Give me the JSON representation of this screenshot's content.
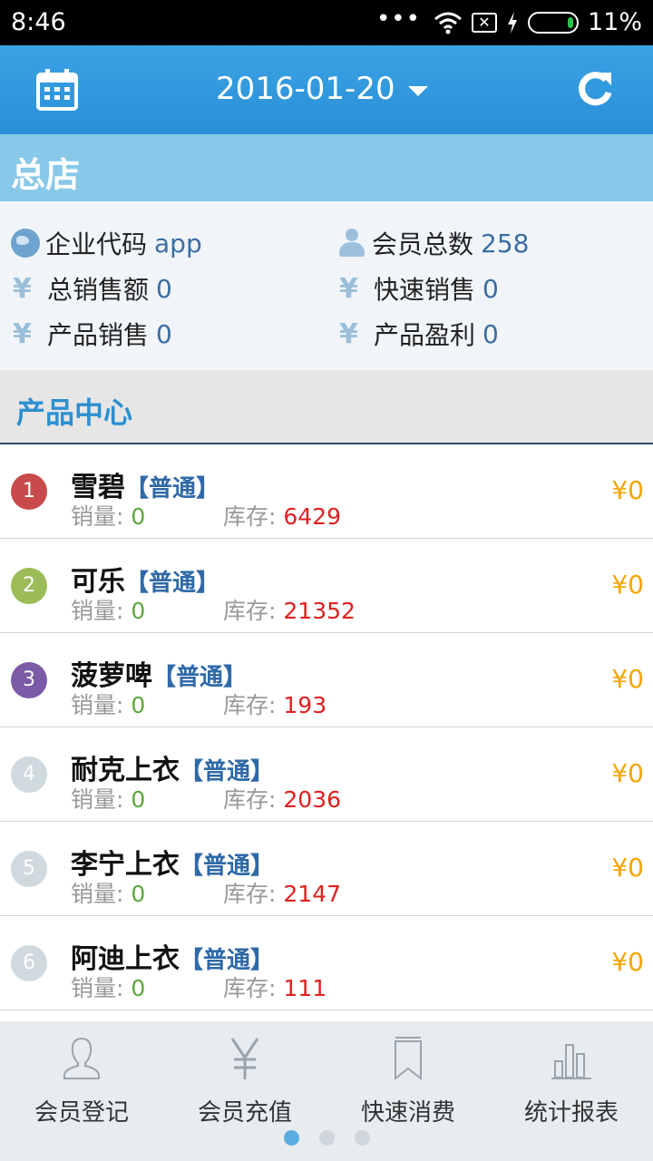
{
  "status_bar": {
    "time": "8:46",
    "dots": "•••",
    "battery_percent": "11%",
    "sim_label": "✕"
  },
  "header": {
    "date": "2016-01-20",
    "calendar_icon": "calendar-icon",
    "refresh_icon": "refresh-icon"
  },
  "store": {
    "name": "总店"
  },
  "info": {
    "company_code_label": "企业代码",
    "company_code_value": "app",
    "member_total_label": "会员总数",
    "member_total_value": "258",
    "total_sales_label": "总销售额",
    "total_sales_value": "0",
    "quick_sales_label": "快速销售",
    "quick_sales_value": "0",
    "product_sales_label": "产品销售",
    "product_sales_value": "0",
    "product_profit_label": "产品盈利",
    "product_profit_value": "0",
    "currency_symbol": "¥"
  },
  "section": {
    "title": "产品中心"
  },
  "products": [
    {
      "rank": "1",
      "name": "雪碧",
      "type": "【普通】",
      "sold_label": "销量:",
      "sold": "0",
      "stock_label": "库存:",
      "stock": "6429",
      "price": "¥0",
      "color": "#c94a4a"
    },
    {
      "rank": "2",
      "name": "可乐",
      "type": "【普通】",
      "sold_label": "销量:",
      "sold": "0",
      "stock_label": "库存:",
      "stock": "21352",
      "price": "¥0",
      "color": "#9bbc57"
    },
    {
      "rank": "3",
      "name": "菠萝啤",
      "type": "【普通】",
      "sold_label": "销量:",
      "sold": "0",
      "stock_label": "库存:",
      "stock": "193",
      "price": "¥0",
      "color": "#7b5aa6"
    },
    {
      "rank": "4",
      "name": "耐克上衣",
      "type": "【普通】",
      "sold_label": "销量:",
      "sold": "0",
      "stock_label": "库存:",
      "stock": "2036",
      "price": "¥0",
      "color": "#d0d9de"
    },
    {
      "rank": "5",
      "name": "李宁上衣",
      "type": "【普通】",
      "sold_label": "销量:",
      "sold": "0",
      "stock_label": "库存:",
      "stock": "2147",
      "price": "¥0",
      "color": "#d0d9de"
    },
    {
      "rank": "6",
      "name": "阿迪上衣",
      "type": "【普通】",
      "sold_label": "销量:",
      "sold": "0",
      "stock_label": "库存:",
      "stock": "111",
      "price": "¥0",
      "color": "#d0d9de"
    }
  ],
  "bottom_nav": [
    {
      "label": "会员登记",
      "icon": "person-outline-icon"
    },
    {
      "label": "会员充值",
      "icon": "yen-icon"
    },
    {
      "label": "快速消费",
      "icon": "bookmark-icon"
    },
    {
      "label": "统计报表",
      "icon": "bar-chart-icon"
    }
  ],
  "pager": {
    "pages": 3,
    "active": 1
  }
}
